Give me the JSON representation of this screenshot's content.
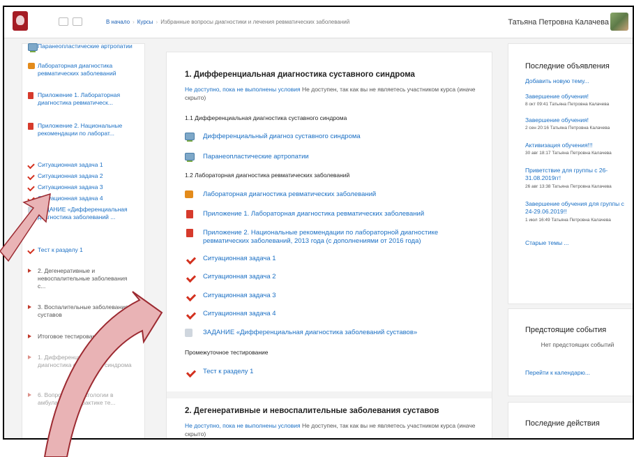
{
  "navbar": {
    "breadcrumbs": [
      "В начало",
      "Курсы",
      "Избранные вопросы диагностики и лечения ревматических заболеваний"
    ],
    "user_name": "Татьяна Петровна Калачева"
  },
  "left": {
    "items": [
      {
        "label": "Паранеопластические артропатии",
        "icon": "screen-icon"
      },
      {
        "label": "Лабораторная диагностика ревматических заболеваний",
        "icon": "puzzle-icon"
      },
      {
        "label": "Приложение 1. Лабораторная диагностика ревматическ...",
        "icon": "pdf-icon"
      },
      {
        "label": "Приложение 2. Национальные рекомендации по лаборат...",
        "icon": "pdf-icon"
      },
      {
        "label": "Ситуационная задача 1",
        "icon": "check-icon"
      },
      {
        "label": "Ситуационная задача 2",
        "icon": "check-icon"
      },
      {
        "label": "Ситуационная задача 3",
        "icon": "check-icon"
      },
      {
        "label": "Ситуационная задача 4",
        "icon": "check-icon"
      },
      {
        "label": "ЗАДАНИЕ «Дифференциальная диагностика заболеваний ...",
        "icon": "assign-icon"
      },
      {
        "label": "Тест к разделу 1",
        "icon": "check-icon"
      }
    ],
    "sections": [
      {
        "label": "2. Дегенеративные и невоспалительные заболевания с..."
      },
      {
        "label": "3. Воспалительные заболевания суставов"
      },
      {
        "label": "Итоговое тестирование"
      },
      {
        "label": "1. Дифференциальная диагностика суставного синдрома"
      },
      {
        "label": "6. Вопросы ревматологии в амбулаторной практике те..."
      }
    ]
  },
  "main": {
    "section1": {
      "title": "1. Дифференциальная диагностика суставного синдрома",
      "restrict_warn": "Не доступно, пока не выполнены условия",
      "restrict_text": "Не доступен, так как вы не являетесь участником курса (иначе скрыто)",
      "sub1": "1.1 Дифференциальная диагностика суставного синдрома",
      "sub2": "1.2 Лабораторная диагностика ревматических заболеваний",
      "sub3": "Промежуточное тестирование",
      "activities": [
        {
          "label": "Дифференциальный диагноз суставного синдрома",
          "icon": "screen-icon"
        },
        {
          "label": "Паранеопластические артропатии",
          "icon": "screen-icon"
        },
        {
          "label": "Лабораторная диагностика ревматических заболеваний",
          "icon": "puzzle-icon"
        },
        {
          "label": "Приложение 1. Лабораторная диагностика ревматических заболеваний",
          "icon": "pdf-icon"
        },
        {
          "label": "Приложение 2. Национальные рекомендации по лабораторной диагностике ревматических заболеваний, 2013 года (с дополнениями от 2016 года)",
          "icon": "pdf-icon"
        },
        {
          "label": "Ситуационная задача 1",
          "icon": "check-icon"
        },
        {
          "label": "Ситуационная задача 2",
          "icon": "check-icon"
        },
        {
          "label": "Ситуационная задача 3",
          "icon": "check-icon"
        },
        {
          "label": "Ситуационная задача 4",
          "icon": "check-icon"
        },
        {
          "label": "ЗАДАНИЕ «Дифференциальная диагностика заболеваний суставов»",
          "icon": "assign-icon"
        },
        {
          "label": "Тест к разделу 1",
          "icon": "check-icon"
        }
      ]
    },
    "section2": {
      "title": "2. Дегенеративные и невоспалительные заболевания суставов",
      "restrict_warn": "Не доступно, пока не выполнены условия",
      "restrict_text": "Не доступен, так как вы не являетесь участником курса (иначе скрыто)"
    }
  },
  "right": {
    "news": {
      "title": "Последние объявления",
      "add_link": "Добавить новую тему...",
      "posts": [
        {
          "title": "Завершение обучения!",
          "meta": "8 окт 09:41 Татьяна Петровна Калачева"
        },
        {
          "title": "Завершение обучения!",
          "meta": "2 сен 20:16 Татьяна Петровна Калачева"
        },
        {
          "title": "Активизация обучения!!!",
          "meta": "30 авг 18:17 Татьяна Петровна Калачева"
        },
        {
          "title": "Приветствие для группы с 26-31.08.2019гг!",
          "meta": "26 авг 13:38 Татьяна Петровна Калачева"
        },
        {
          "title": "Завершение обучения для группы с 24-29.06.2019!!",
          "meta": "1 июл 16:49 Татьяна Петровна Калачева"
        }
      ],
      "old_topics": "Старые темы ..."
    },
    "events": {
      "title": "Предстоящие события",
      "empty": "Нет предстоящих событий",
      "calendar_link": "Перейти к календарю..."
    },
    "recent": {
      "title": "Последние действия"
    }
  },
  "colors": {
    "link": "#1a6fc4",
    "arrow_fill": "#e9b3b5",
    "arrow_stroke": "#9c2a31",
    "brand": "#a51c24"
  }
}
